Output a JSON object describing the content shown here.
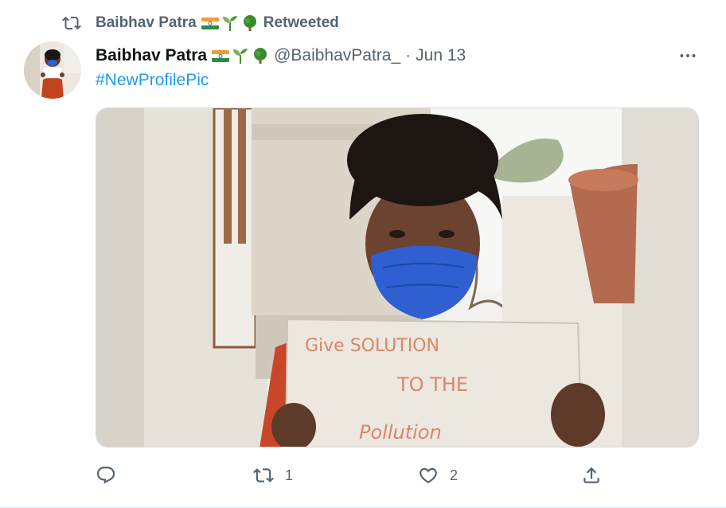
{
  "retweet": {
    "name": "Baibhav Patra",
    "suffix": "Retweeted"
  },
  "author": {
    "name": "Baibhav Patra",
    "handle": "@BaibhavPatra_",
    "separator": "·",
    "date": "Jun 13",
    "emoji_icons": [
      "india-flag-icon",
      "seedling-icon",
      "tree-icon"
    ]
  },
  "tweet": {
    "hashtag": "#NewProfilePic",
    "sign_text": [
      "Give SOLUTION",
      "TO THE",
      "Pollution"
    ]
  },
  "actions": {
    "reply_count": "",
    "retweet_count": "1",
    "like_count": "2"
  },
  "colors": {
    "link": "#1d9bf0",
    "secondary_text": "#536471",
    "primary_text": "#0f1419",
    "mask": "#2f5fd0"
  }
}
